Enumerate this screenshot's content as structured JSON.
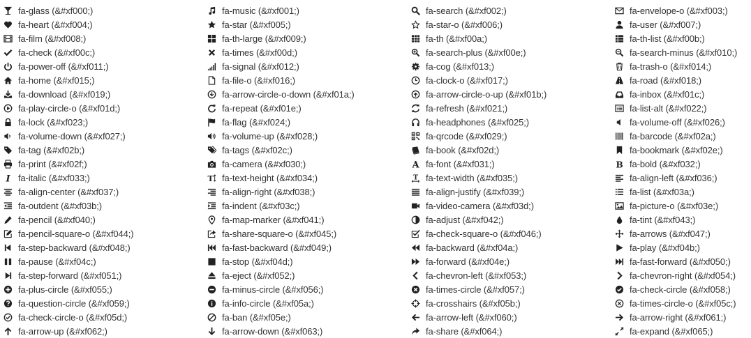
{
  "icons": [
    {
      "name": "fa-glass",
      "code": "(&#xf000;)",
      "glyph": "glass"
    },
    {
      "name": "fa-music",
      "code": "(&#xf001;)",
      "glyph": "music"
    },
    {
      "name": "fa-search",
      "code": "(&#xf002;)",
      "glyph": "search"
    },
    {
      "name": "fa-envelope-o",
      "code": "(&#xf003;)",
      "glyph": "envelope-o"
    },
    {
      "name": "fa-heart",
      "code": "(&#xf004;)",
      "glyph": "heart"
    },
    {
      "name": "fa-star",
      "code": "(&#xf005;)",
      "glyph": "star"
    },
    {
      "name": "fa-star-o",
      "code": "(&#xf006;)",
      "glyph": "star-o"
    },
    {
      "name": "fa-user",
      "code": "(&#xf007;)",
      "glyph": "user"
    },
    {
      "name": "fa-film",
      "code": "(&#xf008;)",
      "glyph": "film"
    },
    {
      "name": "fa-th-large",
      "code": "(&#xf009;)",
      "glyph": "th-large"
    },
    {
      "name": "fa-th",
      "code": "(&#xf00a;)",
      "glyph": "th"
    },
    {
      "name": "fa-th-list",
      "code": "(&#xf00b;)",
      "glyph": "th-list"
    },
    {
      "name": "fa-check",
      "code": "(&#xf00c;)",
      "glyph": "check"
    },
    {
      "name": "fa-times",
      "code": "(&#xf00d;)",
      "glyph": "times"
    },
    {
      "name": "fa-search-plus",
      "code": "(&#xf00e;)",
      "glyph": "search-plus"
    },
    {
      "name": "fa-search-minus",
      "code": "(&#xf010;)",
      "glyph": "search-minus"
    },
    {
      "name": "fa-power-off",
      "code": "(&#xf011;)",
      "glyph": "power-off"
    },
    {
      "name": "fa-signal",
      "code": "(&#xf012;)",
      "glyph": "signal"
    },
    {
      "name": "fa-cog",
      "code": "(&#xf013;)",
      "glyph": "cog"
    },
    {
      "name": "fa-trash-o",
      "code": "(&#xf014;)",
      "glyph": "trash-o"
    },
    {
      "name": "fa-home",
      "code": "(&#xf015;)",
      "glyph": "home"
    },
    {
      "name": "fa-file-o",
      "code": "(&#xf016;)",
      "glyph": "file-o"
    },
    {
      "name": "fa-clock-o",
      "code": "(&#xf017;)",
      "glyph": "clock-o"
    },
    {
      "name": "fa-road",
      "code": "(&#xf018;)",
      "glyph": "road"
    },
    {
      "name": "fa-download",
      "code": "(&#xf019;)",
      "glyph": "download"
    },
    {
      "name": "fa-arrow-circle-o-down",
      "code": "(&#xf01a;)",
      "glyph": "arrow-circle-o-down"
    },
    {
      "name": "fa-arrow-circle-o-up",
      "code": "(&#xf01b;)",
      "glyph": "arrow-circle-o-up"
    },
    {
      "name": "fa-inbox",
      "code": "(&#xf01c;)",
      "glyph": "inbox"
    },
    {
      "name": "fa-play-circle-o",
      "code": "(&#xf01d;)",
      "glyph": "play-circle-o"
    },
    {
      "name": "fa-repeat",
      "code": "(&#xf01e;)",
      "glyph": "repeat"
    },
    {
      "name": "fa-refresh",
      "code": "(&#xf021;)",
      "glyph": "refresh"
    },
    {
      "name": "fa-list-alt",
      "code": "(&#xf022;)",
      "glyph": "list-alt"
    },
    {
      "name": "fa-lock",
      "code": "(&#xf023;)",
      "glyph": "lock"
    },
    {
      "name": "fa-flag",
      "code": "(&#xf024;)",
      "glyph": "flag"
    },
    {
      "name": "fa-headphones",
      "code": "(&#xf025;)",
      "glyph": "headphones"
    },
    {
      "name": "fa-volume-off",
      "code": "(&#xf026;)",
      "glyph": "volume-off"
    },
    {
      "name": "fa-volume-down",
      "code": "(&#xf027;)",
      "glyph": "volume-down"
    },
    {
      "name": "fa-volume-up",
      "code": "(&#xf028;)",
      "glyph": "volume-up"
    },
    {
      "name": "fa-qrcode",
      "code": "(&#xf029;)",
      "glyph": "qrcode"
    },
    {
      "name": "fa-barcode",
      "code": "(&#xf02a;)",
      "glyph": "barcode"
    },
    {
      "name": "fa-tag",
      "code": "(&#xf02b;)",
      "glyph": "tag"
    },
    {
      "name": "fa-tags",
      "code": "(&#xf02c;)",
      "glyph": "tags"
    },
    {
      "name": "fa-book",
      "code": "(&#xf02d;)",
      "glyph": "book"
    },
    {
      "name": "fa-bookmark",
      "code": "(&#xf02e;)",
      "glyph": "bookmark"
    },
    {
      "name": "fa-print",
      "code": "(&#xf02f;)",
      "glyph": "print"
    },
    {
      "name": "fa-camera",
      "code": "(&#xf030;)",
      "glyph": "camera"
    },
    {
      "name": "fa-font",
      "code": "(&#xf031;)",
      "glyph": "font"
    },
    {
      "name": "fa-bold",
      "code": "(&#xf032;)",
      "glyph": "bold"
    },
    {
      "name": "fa-italic",
      "code": "(&#xf033;)",
      "glyph": "italic"
    },
    {
      "name": "fa-text-height",
      "code": "(&#xf034;)",
      "glyph": "text-height"
    },
    {
      "name": "fa-text-width",
      "code": "(&#xf035;)",
      "glyph": "text-width"
    },
    {
      "name": "fa-align-left",
      "code": "(&#xf036;)",
      "glyph": "align-left"
    },
    {
      "name": "fa-align-center",
      "code": "(&#xf037;)",
      "glyph": "align-center"
    },
    {
      "name": "fa-align-right",
      "code": "(&#xf038;)",
      "glyph": "align-right"
    },
    {
      "name": "fa-align-justify",
      "code": "(&#xf039;)",
      "glyph": "align-justify"
    },
    {
      "name": "fa-list",
      "code": "(&#xf03a;)",
      "glyph": "list"
    },
    {
      "name": "fa-outdent",
      "code": "(&#xf03b;)",
      "glyph": "outdent"
    },
    {
      "name": "fa-indent",
      "code": "(&#xf03c;)",
      "glyph": "indent"
    },
    {
      "name": "fa-video-camera",
      "code": "(&#xf03d;)",
      "glyph": "video-camera"
    },
    {
      "name": "fa-picture-o",
      "code": "(&#xf03e;)",
      "glyph": "picture-o"
    },
    {
      "name": "fa-pencil",
      "code": "(&#xf040;)",
      "glyph": "pencil"
    },
    {
      "name": "fa-map-marker",
      "code": "(&#xf041;)",
      "glyph": "map-marker"
    },
    {
      "name": "fa-adjust",
      "code": "(&#xf042;)",
      "glyph": "adjust"
    },
    {
      "name": "fa-tint",
      "code": "(&#xf043;)",
      "glyph": "tint"
    },
    {
      "name": "fa-pencil-square-o",
      "code": "(&#xf044;)",
      "glyph": "pencil-square-o"
    },
    {
      "name": "fa-share-square-o",
      "code": "(&#xf045;)",
      "glyph": "share-square-o"
    },
    {
      "name": "fa-check-square-o",
      "code": "(&#xf046;)",
      "glyph": "check-square-o"
    },
    {
      "name": "fa-arrows",
      "code": "(&#xf047;)",
      "glyph": "arrows"
    },
    {
      "name": "fa-step-backward",
      "code": "(&#xf048;)",
      "glyph": "step-backward"
    },
    {
      "name": "fa-fast-backward",
      "code": "(&#xf049;)",
      "glyph": "fast-backward"
    },
    {
      "name": "fa-backward",
      "code": "(&#xf04a;)",
      "glyph": "backward"
    },
    {
      "name": "fa-play",
      "code": "(&#xf04b;)",
      "glyph": "play"
    },
    {
      "name": "fa-pause",
      "code": "(&#xf04c;)",
      "glyph": "pause"
    },
    {
      "name": "fa-stop",
      "code": "(&#xf04d;)",
      "glyph": "stop"
    },
    {
      "name": "fa-forward",
      "code": "(&#xf04e;)",
      "glyph": "forward"
    },
    {
      "name": "fa-fast-forward",
      "code": "(&#xf050;)",
      "glyph": "fast-forward"
    },
    {
      "name": "fa-step-forward",
      "code": "(&#xf051;)",
      "glyph": "step-forward"
    },
    {
      "name": "fa-eject",
      "code": "(&#xf052;)",
      "glyph": "eject"
    },
    {
      "name": "fa-chevron-left",
      "code": "(&#xf053;)",
      "glyph": "chevron-left"
    },
    {
      "name": "fa-chevron-right",
      "code": "(&#xf054;)",
      "glyph": "chevron-right"
    },
    {
      "name": "fa-plus-circle",
      "code": "(&#xf055;)",
      "glyph": "plus-circle"
    },
    {
      "name": "fa-minus-circle",
      "code": "(&#xf056;)",
      "glyph": "minus-circle"
    },
    {
      "name": "fa-times-circle",
      "code": "(&#xf057;)",
      "glyph": "times-circle"
    },
    {
      "name": "fa-check-circle",
      "code": "(&#xf058;)",
      "glyph": "check-circle"
    },
    {
      "name": "fa-question-circle",
      "code": "(&#xf059;)",
      "glyph": "question-circle"
    },
    {
      "name": "fa-info-circle",
      "code": "(&#xf05a;)",
      "glyph": "info-circle"
    },
    {
      "name": "fa-crosshairs",
      "code": "(&#xf05b;)",
      "glyph": "crosshairs"
    },
    {
      "name": "fa-times-circle-o",
      "code": "(&#xf05c;)",
      "glyph": "times-circle-o"
    },
    {
      "name": "fa-check-circle-o",
      "code": "(&#xf05d;)",
      "glyph": "check-circle-o"
    },
    {
      "name": "fa-ban",
      "code": "(&#xf05e;)",
      "glyph": "ban"
    },
    {
      "name": "fa-arrow-left",
      "code": "(&#xf060;)",
      "glyph": "arrow-left"
    },
    {
      "name": "fa-arrow-right",
      "code": "(&#xf061;)",
      "glyph": "arrow-right"
    },
    {
      "name": "fa-arrow-up",
      "code": "(&#xf062;)",
      "glyph": "arrow-up"
    },
    {
      "name": "fa-arrow-down",
      "code": "(&#xf063;)",
      "glyph": "arrow-down"
    },
    {
      "name": "fa-share",
      "code": "(&#xf064;)",
      "glyph": "share"
    },
    {
      "name": "fa-expand",
      "code": "(&#xf065;)",
      "glyph": "expand"
    }
  ]
}
